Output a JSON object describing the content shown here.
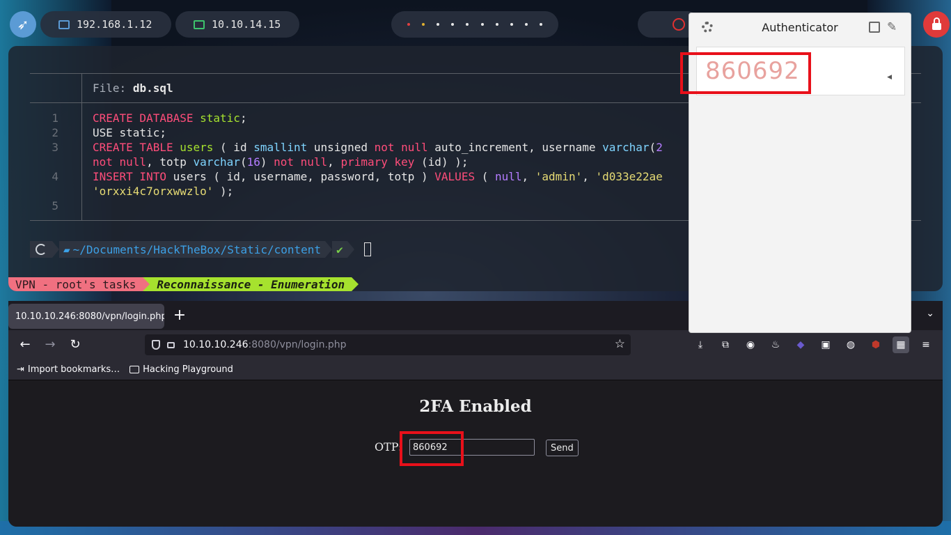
{
  "topbar": {
    "ip_local": "192.168.1.12",
    "ip_vpn": "10.10.14.15",
    "colors": {
      "accent_blue": "#5b9bd5",
      "lock_red": "#e03a3a",
      "vpn_green": "#3ec46d"
    }
  },
  "terminal": {
    "file_label": "File:",
    "file_name": "db.sql",
    "lines": [
      {
        "no": "1",
        "text_parts": [
          "CREATE DATABASE",
          " ",
          "static",
          ";"
        ]
      },
      {
        "no": "2",
        "text": "USE static;"
      },
      {
        "no": "3"
      },
      {
        "no": "4"
      },
      {
        "no": "5"
      }
    ],
    "prompt": {
      "path_prefix": "~/Documents/HackTheBox/Static/",
      "path_current": "content",
      "check": "✔"
    },
    "tasks": {
      "vpn": "VPN - root's tasks",
      "recon": "Reconnaissance - Enumeration"
    }
  },
  "browser": {
    "tab_title": "10.10.10.246:8080/vpn/login.php",
    "url_host": "10.10.10.246",
    "url_rest": ":8080/vpn/login.php",
    "bookmarks": [
      "Import bookmarks…",
      "Hacking Playground"
    ],
    "page": {
      "heading": "2FA Enabled",
      "otp_label": "OTP:",
      "otp_value": "860692",
      "send_label": "Send"
    }
  },
  "authenticator": {
    "title": "Authenticator",
    "code": "860692"
  }
}
